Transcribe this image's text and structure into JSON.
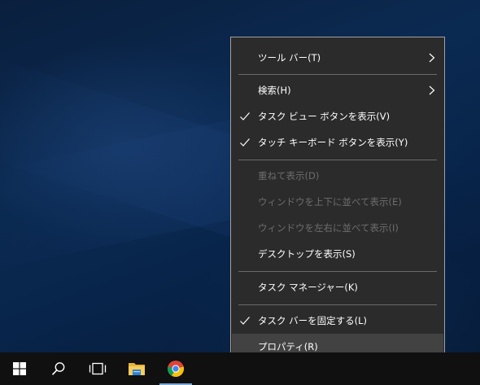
{
  "context_menu": {
    "items": [
      {
        "label": "ツール バー(T)",
        "checked": false,
        "enabled": true,
        "submenu": true,
        "icon": "chevron-right-icon"
      },
      {
        "label": "検索(H)",
        "checked": false,
        "enabled": true,
        "submenu": true,
        "icon": "chevron-right-icon"
      },
      {
        "label": "タスク ビュー ボタンを表示(V)",
        "checked": true,
        "enabled": true,
        "icon": "checkmark-icon"
      },
      {
        "label": "タッチ キーボード ボタンを表示(Y)",
        "checked": true,
        "enabled": true,
        "icon": "checkmark-icon"
      },
      {
        "label": "重ねて表示(D)",
        "checked": false,
        "enabled": false
      },
      {
        "label": "ウィンドウを上下に並べて表示(E)",
        "checked": false,
        "enabled": false
      },
      {
        "label": "ウィンドウを左右に並べて表示(I)",
        "checked": false,
        "enabled": false
      },
      {
        "label": "デスクトップを表示(S)",
        "checked": false,
        "enabled": true
      },
      {
        "label": "タスク マネージャー(K)",
        "checked": false,
        "enabled": true
      },
      {
        "label": "タスク バーを固定する(L)",
        "checked": true,
        "enabled": true,
        "icon": "checkmark-icon"
      },
      {
        "label": "プロパティ(R)",
        "checked": false,
        "enabled": true,
        "highlighted": true
      }
    ]
  },
  "taskbar": {
    "buttons": [
      {
        "icon": "windows-start-icon"
      },
      {
        "icon": "search-icon"
      },
      {
        "icon": "task-view-icon"
      },
      {
        "icon": "file-explorer-icon"
      },
      {
        "icon": "chrome-icon",
        "active": true
      }
    ]
  },
  "colors": {
    "menu_background": "#2b2b2b",
    "menu_border": "#a0a0a0",
    "menu_text": "#ffffff",
    "menu_disabled_text": "#6d6d6d",
    "menu_hover": "#424242",
    "taskbar": "#101010"
  }
}
